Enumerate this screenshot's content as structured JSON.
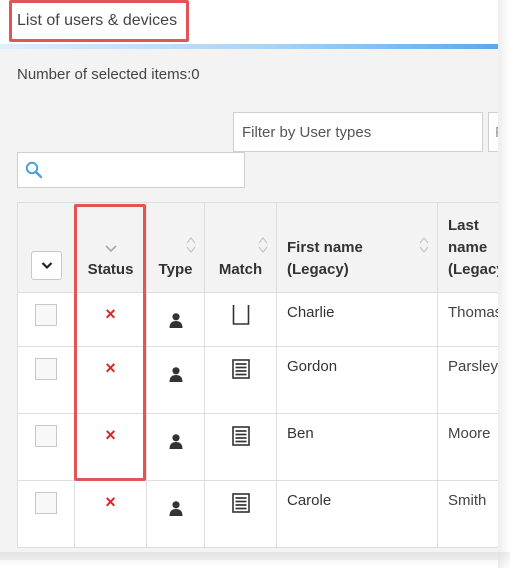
{
  "header": {
    "title": "List of users & devices"
  },
  "summary": {
    "selected_label": "Number of selected items:0"
  },
  "filters": {
    "user_types_placeholder": "Filter by User types",
    "second_placeholder": "Fi"
  },
  "search": {
    "value": ""
  },
  "table": {
    "columns": {
      "status": "Status",
      "type": "Type",
      "match": "Match",
      "first_name_line1": "First name",
      "first_name_line2": "(Legacy)",
      "last_name_line1": "Last",
      "last_name_line2": "name",
      "last_name_line3": "(Legacy)"
    },
    "rows": [
      {
        "status": "×",
        "first_name": "Charlie",
        "last_name": "Thomas",
        "match_icon": "empty-doc-icon"
      },
      {
        "status": "×",
        "first_name": "Gordon",
        "last_name": "Parsley",
        "match_icon": "list-doc-icon"
      },
      {
        "status": "×",
        "first_name": "Ben",
        "last_name": "Moore",
        "match_icon": "list-doc-icon"
      },
      {
        "status": "×",
        "first_name": "Carole",
        "last_name": "Smith",
        "match_icon": "list-doc-icon"
      }
    ]
  },
  "colors": {
    "accent_blue": "#5aa9ec",
    "highlight_red": "#e05656",
    "status_red": "#d42b2b"
  }
}
